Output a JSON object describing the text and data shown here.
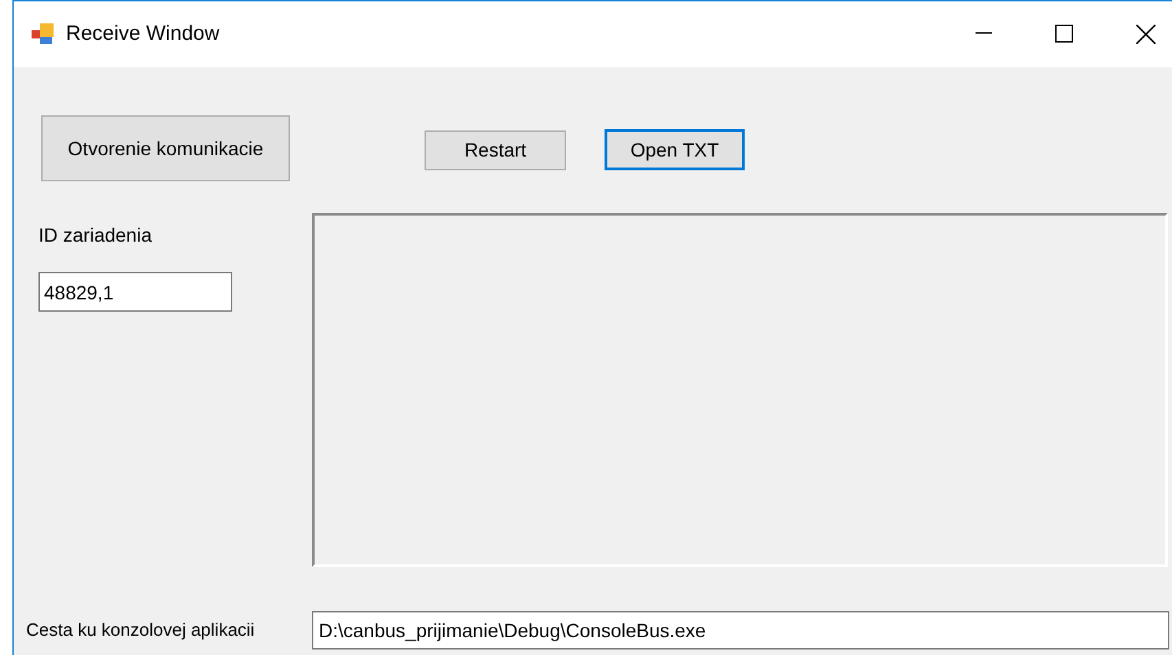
{
  "window": {
    "title": "Receive Window"
  },
  "buttons": [
    {
      "label": "Otvorenie komunikacie",
      "focused": false
    },
    {
      "label": "Restart",
      "focused": false
    },
    {
      "label": "Open TXT",
      "focused": true
    }
  ],
  "device_id": {
    "label": "ID zariadenia",
    "value": "48829,1"
  },
  "console_path": {
    "label": "Cesta ku konzolovej aplikacii",
    "value": "D:\\canbus_prijimanie\\Debug\\ConsoleBus.exe"
  }
}
